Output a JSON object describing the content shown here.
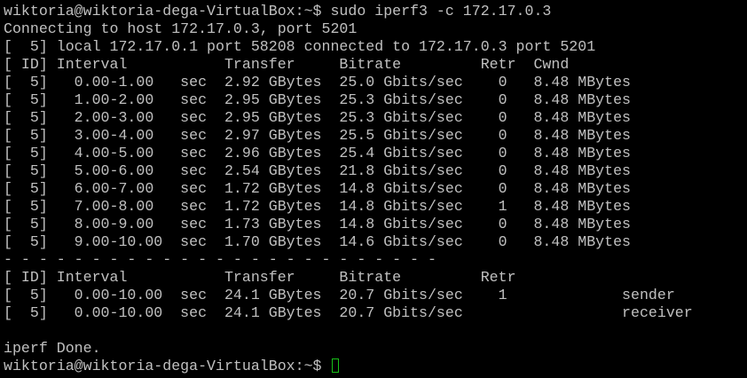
{
  "terminal": {
    "lines": [
      "wiktoria@wiktoria-dega-VirtualBox:~$ sudo iperf3 -c 172.17.0.3",
      "Connecting to host 172.17.0.3, port 5201",
      "[  5] local 172.17.0.1 port 58208 connected to 172.17.0.3 port 5201",
      "[ ID] Interval           Transfer     Bitrate         Retr  Cwnd",
      "[  5]   0.00-1.00   sec  2.92 GBytes  25.0 Gbits/sec    0   8.48 MBytes",
      "[  5]   1.00-2.00   sec  2.95 GBytes  25.3 Gbits/sec    0   8.48 MBytes",
      "[  5]   2.00-3.00   sec  2.95 GBytes  25.3 Gbits/sec    0   8.48 MBytes",
      "[  5]   3.00-4.00   sec  2.97 GBytes  25.5 Gbits/sec    0   8.48 MBytes",
      "[  5]   4.00-5.00   sec  2.96 GBytes  25.4 Gbits/sec    0   8.48 MBytes",
      "[  5]   5.00-6.00   sec  2.54 GBytes  21.8 Gbits/sec    0   8.48 MBytes",
      "[  5]   6.00-7.00   sec  1.72 GBytes  14.8 Gbits/sec    0   8.48 MBytes",
      "[  5]   7.00-8.00   sec  1.72 GBytes  14.8 Gbits/sec    1   8.48 MBytes",
      "[  5]   8.00-9.00   sec  1.73 GBytes  14.8 Gbits/sec    0   8.48 MBytes",
      "[  5]   9.00-10.00  sec  1.70 GBytes  14.6 Gbits/sec    0   8.48 MBytes",
      "- - - - - - - - - - - - - - - - - - - - - - - - -",
      "[ ID] Interval           Transfer     Bitrate         Retr",
      "[  5]   0.00-10.00  sec  24.1 GBytes  20.7 Gbits/sec    1             sender",
      "[  5]   0.00-10.00  sec  24.1 GBytes  20.7 Gbits/sec                  receiver",
      "",
      "iperf Done."
    ],
    "prompt": "wiktoria@wiktoria-dega-VirtualBox:~$ ",
    "cursor_color": "#18c018",
    "text_color": "#c0c0c0",
    "background_color": "#000000"
  }
}
